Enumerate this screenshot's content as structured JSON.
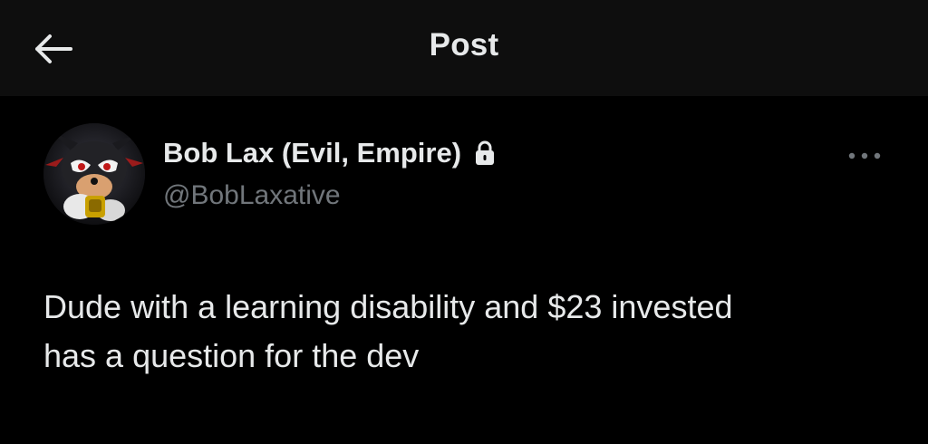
{
  "header": {
    "title": "Post",
    "back_icon": "arrow-left-icon"
  },
  "post": {
    "author": {
      "display_name": "Bob Lax (Evil, Empire)",
      "handle": "@BobLaxative",
      "protected_icon": "lock-icon",
      "avatar_icon": "avatar-image"
    },
    "more_icon": "more-horizontal-icon",
    "text_line_1": "Dude with a learning disability and $23 invested",
    "text_line_2": "has a question for the dev"
  },
  "colors": {
    "background": "#000000",
    "header_background": "#0e0e0e",
    "primary_text": "#e7e9ea",
    "secondary_text": "#71767b"
  }
}
